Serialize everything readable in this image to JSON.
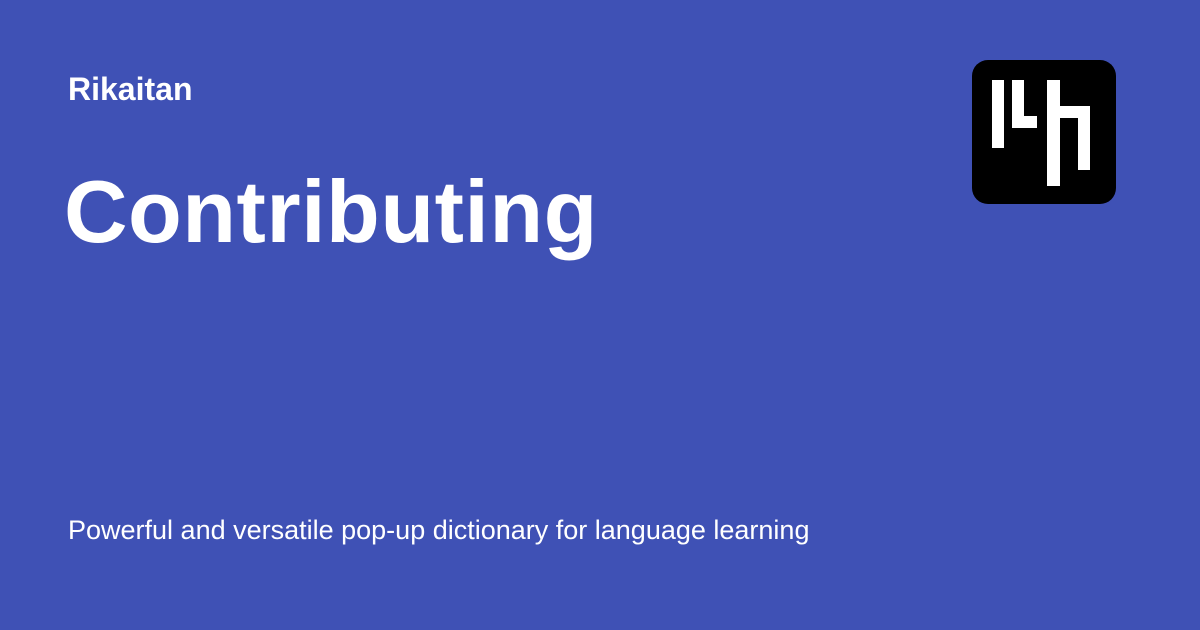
{
  "site": {
    "name": "Rikaitan",
    "logo_icon": "rikaitan-logo-icon"
  },
  "page": {
    "title": "Contributing",
    "description": "Powerful and versatile pop-up dictionary for language learning"
  },
  "colors": {
    "background": "#3f51b5",
    "text": "#ffffff",
    "logo_background": "#000000",
    "logo_glyph": "#ffffff"
  }
}
